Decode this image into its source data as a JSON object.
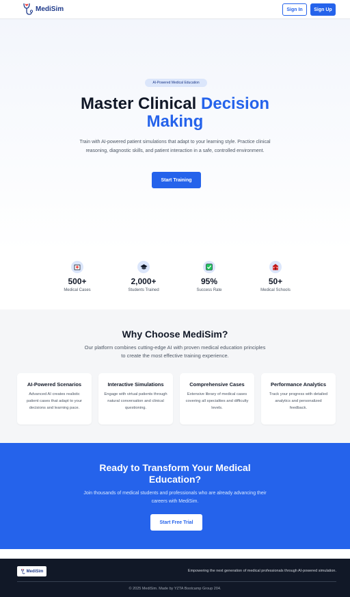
{
  "header": {
    "brand": "MediSim",
    "sign_in": "Sign In",
    "sign_up": "Sign Up"
  },
  "hero": {
    "badge": "AI-Powered Medical Education",
    "title_part1": "Master Clinical ",
    "title_accent1": "Decision",
    "title_accent2": "Making",
    "description": "Train with AI-powered patient simulations that adapt to your learning style. Practice clinical reasoning, diagnostic skills, and patient interaction in a safe, controlled environment.",
    "cta": "Start Training"
  },
  "stats": [
    {
      "icon": "hospital-icon",
      "value": "500+",
      "label": "Medical Cases"
    },
    {
      "icon": "graduation-cap-icon",
      "value": "2,000+",
      "label": "Students Trained"
    },
    {
      "icon": "check-mark-icon",
      "value": "95%",
      "label": "Success Rate"
    },
    {
      "icon": "school-icon",
      "value": "50+",
      "label": "Medical Schools"
    }
  ],
  "features": {
    "title": "Why Choose MediSim?",
    "description": "Our platform combines cutting-edge AI with proven medical education principles to create the most effective training experience.",
    "cards": [
      {
        "title": "AI-Powered Scenarios",
        "description": "Advanced AI creates realistic patient cases that adapt to your decisions and learning pace."
      },
      {
        "title": "Interactive Simulations",
        "description": "Engage with virtual patients through natural conversation and clinical questioning."
      },
      {
        "title": "Comprehensive Cases",
        "description": "Extensive library of medical cases covering all specialties and difficulty levels."
      },
      {
        "title": "Performance Analytics",
        "description": "Track your progress with detailed analytics and personalized feedback."
      }
    ]
  },
  "cta": {
    "title": "Ready to Transform Your Medical Education?",
    "description": "Join thousands of medical students and professionals who are already advancing their careers with MediSim.",
    "button": "Start Free Trial"
  },
  "footer": {
    "brand": "MediSim",
    "tagline": "Empowering the next generation of medical professionals through AI-powered simulation.",
    "copyright": "© 2025 MediSim. Made by YZTA Bootcamp Group 204."
  },
  "colors": {
    "primary": "#2563eb",
    "dark": "#111827"
  }
}
